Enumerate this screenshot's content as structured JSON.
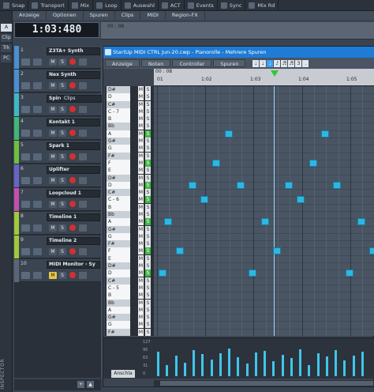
{
  "toolbar": [
    {
      "label": "Snap"
    },
    {
      "label": "Transport"
    },
    {
      "label": "Mix"
    },
    {
      "label": "Loop"
    },
    {
      "label": "Auswahl"
    },
    {
      "label": "ACT"
    },
    {
      "label": "Events"
    },
    {
      "label": "Sync"
    },
    {
      "label": "Mix Rd"
    }
  ],
  "menu2": [
    "Anzeige",
    "Optionen",
    "Spuren",
    "Clips",
    "MIDI",
    "Region-FX"
  ],
  "inspector": {
    "buttons": [
      "Clip",
      "Trk",
      "PC"
    ],
    "label": "INSPECTOR"
  },
  "time_display": "1:03:480",
  "main_ruler": {
    "label": "00 : 08"
  },
  "tracks": [
    {
      "num": "1",
      "name": "Z3TA+ Synth",
      "color": "#4a8fd1"
    },
    {
      "num": "2",
      "name": "Nex Synth",
      "color": "#4a8fd1",
      "dropdown": "Clips"
    },
    {
      "num": "3",
      "name": "Spire Synth",
      "color": "#3fb7c9"
    },
    {
      "num": "4",
      "name": "Kontakt 1",
      "color": "#3fb775"
    },
    {
      "num": "5",
      "name": "Spark 1",
      "color": "#6fbf3d"
    },
    {
      "num": "6",
      "name": "Uplifter",
      "color": "#6a63c7"
    },
    {
      "num": "7",
      "name": "Loopcloud 1",
      "color": "#c54fae"
    },
    {
      "num": "8",
      "name": "Timeline 1",
      "color": "#a3c83a"
    },
    {
      "num": "9",
      "name": "Timeline 2",
      "color": "#a3c83a"
    },
    {
      "num": "10",
      "name": "MIDI Monitor - Sy",
      "color": "#5a6676"
    }
  ],
  "piano_roll": {
    "title": "StartUp MIDI CTRL Jun-20.cwp - Pianorolle - Mehrere Spuren",
    "menu": [
      "Anzeige",
      "Noten",
      "Controller",
      "Spuren"
    ],
    "ruler_sel": "00 : 08",
    "ruler_labels": [
      "01",
      "1:02",
      "1:03",
      "1:04",
      "1:05"
    ],
    "keys": [
      {
        "label": "D#",
        "num": "87",
        "black": true
      },
      {
        "label": "D",
        "num": "86",
        "black": false
      },
      {
        "label": "C#",
        "num": "85",
        "black": true
      },
      {
        "label": "C - 7",
        "num": "84",
        "black": false
      },
      {
        "label": "B",
        "num": "83",
        "black": false
      },
      {
        "label": "Bb",
        "num": "82",
        "black": true
      },
      {
        "label": "A",
        "num": "81",
        "black": false,
        "solo": true
      },
      {
        "label": "G#",
        "num": "80",
        "black": true
      },
      {
        "label": "G",
        "num": "79",
        "black": false
      },
      {
        "label": "F#",
        "num": "78",
        "black": true
      },
      {
        "label": "F",
        "num": "77",
        "black": false,
        "solo": true
      },
      {
        "label": "E",
        "num": "76",
        "black": false
      },
      {
        "label": "D#",
        "num": "75",
        "black": true
      },
      {
        "label": "D",
        "num": "74",
        "black": false,
        "solo": true
      },
      {
        "label": "C#",
        "num": "73",
        "black": true
      },
      {
        "label": "C - 6",
        "num": "72",
        "black": false,
        "solo": true
      },
      {
        "label": "B",
        "num": "71",
        "black": false
      },
      {
        "label": "Bb",
        "num": "70",
        "black": true
      },
      {
        "label": "A",
        "num": "69",
        "black": false,
        "solo": true
      },
      {
        "label": "G#",
        "num": "68",
        "black": true
      },
      {
        "label": "G",
        "num": "67",
        "black": false
      },
      {
        "label": "F#",
        "num": "66",
        "black": true
      },
      {
        "label": "F",
        "num": "65",
        "black": false,
        "solo": true
      },
      {
        "label": "E",
        "num": "64",
        "black": false
      },
      {
        "label": "D#",
        "num": "63",
        "black": true
      },
      {
        "label": "D",
        "num": "62",
        "black": false,
        "solo": true
      },
      {
        "label": "C#",
        "num": "61",
        "black": true
      },
      {
        "label": "C - 5",
        "num": "60",
        "black": false
      },
      {
        "label": "B",
        "num": "59",
        "black": false
      },
      {
        "label": "Bb",
        "num": "58",
        "black": true
      },
      {
        "label": "A",
        "num": "57",
        "black": false
      },
      {
        "label": "G#",
        "num": "56",
        "black": true
      },
      {
        "label": "G",
        "num": "55",
        "black": false
      },
      {
        "label": "F#",
        "num": "54",
        "black": true
      }
    ],
    "velocity_button": "Anschla",
    "velocity_scale": [
      "127",
      "95",
      "63",
      "31",
      "0"
    ]
  },
  "notes": [
    {
      "key": 81,
      "beat": 5.6
    },
    {
      "key": 81,
      "beat": 13.6
    },
    {
      "key": 77,
      "beat": 12.6
    },
    {
      "key": 77,
      "beat": 4.6
    },
    {
      "key": 74,
      "beat": 2.6
    },
    {
      "key": 74,
      "beat": 6.6
    },
    {
      "key": 74,
      "beat": 10.6
    },
    {
      "key": 74,
      "beat": 14.6
    },
    {
      "key": 72,
      "beat": 3.6
    },
    {
      "key": 72,
      "beat": 11.6
    },
    {
      "key": 69,
      "beat": 0.6
    },
    {
      "key": 69,
      "beat": 8.6
    },
    {
      "key": 69,
      "beat": 16.6
    },
    {
      "key": 65,
      "beat": 1.6
    },
    {
      "key": 65,
      "beat": 9.6
    },
    {
      "key": 65,
      "beat": 17.6
    },
    {
      "key": 62,
      "beat": 0.1
    },
    {
      "key": 62,
      "beat": 7.6
    },
    {
      "key": 62,
      "beat": 15.6
    }
  ],
  "velocities": [
    90,
    40,
    75,
    50,
    95,
    80,
    60,
    85,
    100,
    70,
    45,
    88,
    92,
    55,
    78,
    66,
    98,
    40,
    84,
    72,
    95,
    58,
    76,
    90
  ]
}
